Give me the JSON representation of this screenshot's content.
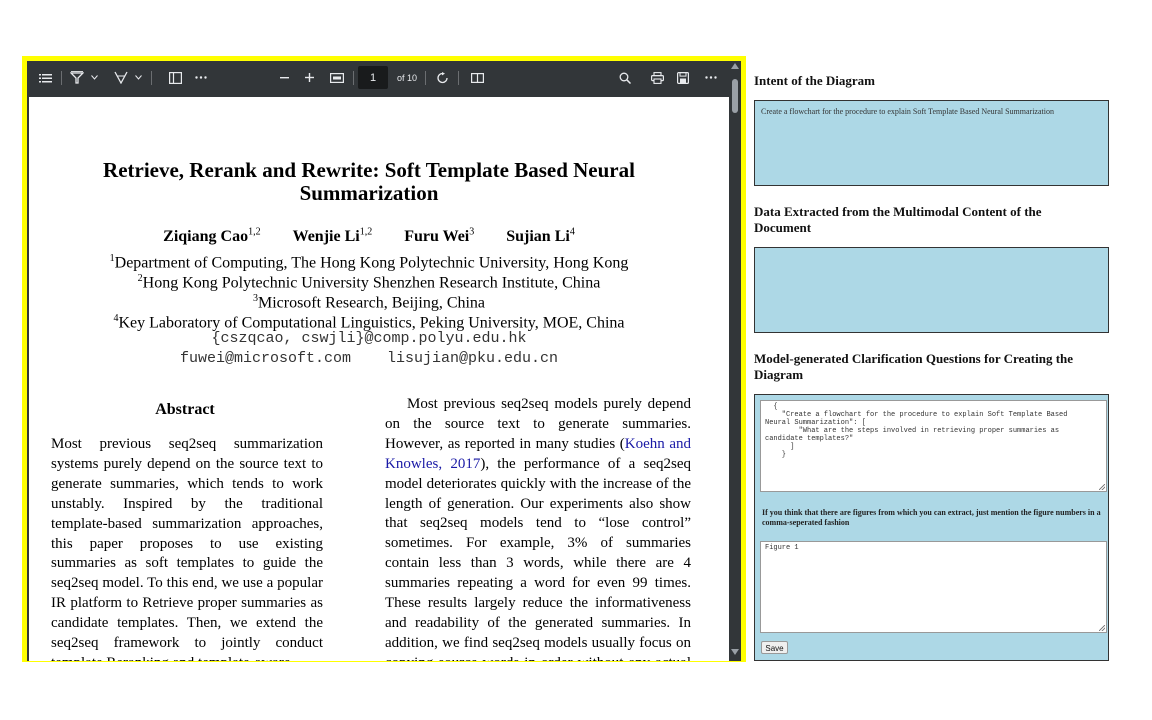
{
  "viewer": {
    "page_number": "1",
    "page_of": "of 10"
  },
  "paper": {
    "title_line1": "Retrieve, Rerank and Rewrite: Soft Template Based Neural",
    "title_line2": "Summarization",
    "authors": [
      {
        "name": "Ziqiang Cao",
        "sup": "1,2"
      },
      {
        "name": "Wenjie Li",
        "sup": "1,2"
      },
      {
        "name": "Furu Wei",
        "sup": "3"
      },
      {
        "name": "Sujian Li",
        "sup": "4"
      }
    ],
    "affiliations": [
      {
        "sup": "1",
        "text": "Department of Computing, The Hong Kong Polytechnic University, Hong Kong"
      },
      {
        "sup": "2",
        "text": "Hong Kong Polytechnic University Shenzhen Research Institute, China"
      },
      {
        "sup": "3",
        "text": "Microsoft Research, Beijing, China"
      },
      {
        "sup": "4",
        "text": "Key Laboratory of Computational Linguistics, Peking University, MOE, China"
      }
    ],
    "email1": "{cszqcao, cswjli}@comp.polyu.edu.hk",
    "email2": "fuwei@microsoft.com    lisujian@pku.edu.cn",
    "abstract_heading": "Abstract",
    "abstract_text": "Most previous seq2seq summarization systems purely depend on the source text to generate summaries, which tends to work unstably. Inspired by the traditional template-based summarization approaches, this paper proposes to use existing summaries as soft templates to guide the seq2seq model. To this end, we use a popular IR platform to Retrieve proper summaries as candidate templates. Then, we extend the seq2seq framework to jointly conduct template Reranking and template-aware",
    "intro_before_cite": "Most previous seq2seq models purely depend on the source text to generate summaries. However, as reported in many studies (",
    "intro_cite": "Koehn and Knowles, 2017",
    "intro_after_cite": "), the performance of a seq2seq model deteriorates quickly with the increase of the length of generation. Our experiments also show that seq2seq models tend to “lose control” sometimes. For example, 3% of summaries contain less than 3 words, while there are 4 summaries repeating a word for even 99 times. These results largely reduce the informativeness and readability of the generated summaries. In addition, we find seq2seq models usually focus on copying source words in order without any actual “summarization”. Therefore"
  },
  "panel": {
    "intent_title": "Intent of the Diagram",
    "intent_text": "Create a flowchart for the procedure to explain Soft Template Based Neural Summarization",
    "data_title": "Data Extracted from the Multimodal Content of the Document",
    "data_text": "",
    "questions_title": "Model-generated Clarification Questions for Creating the Diagram",
    "questions_json": "  {\n    \"Create a flowchart for the procedure to explain Soft Template Based\nNeural Summarization\": [\n        \"What are the steps involved in retrieving proper summaries as\ncandidate templates?\"\n      ]\n    }",
    "figures_label": "If you think that there are figures from which you can extract, just mention the figure numbers in a comma-seperated fashion",
    "figures_value": "Figure 1",
    "save_label": "Save"
  }
}
